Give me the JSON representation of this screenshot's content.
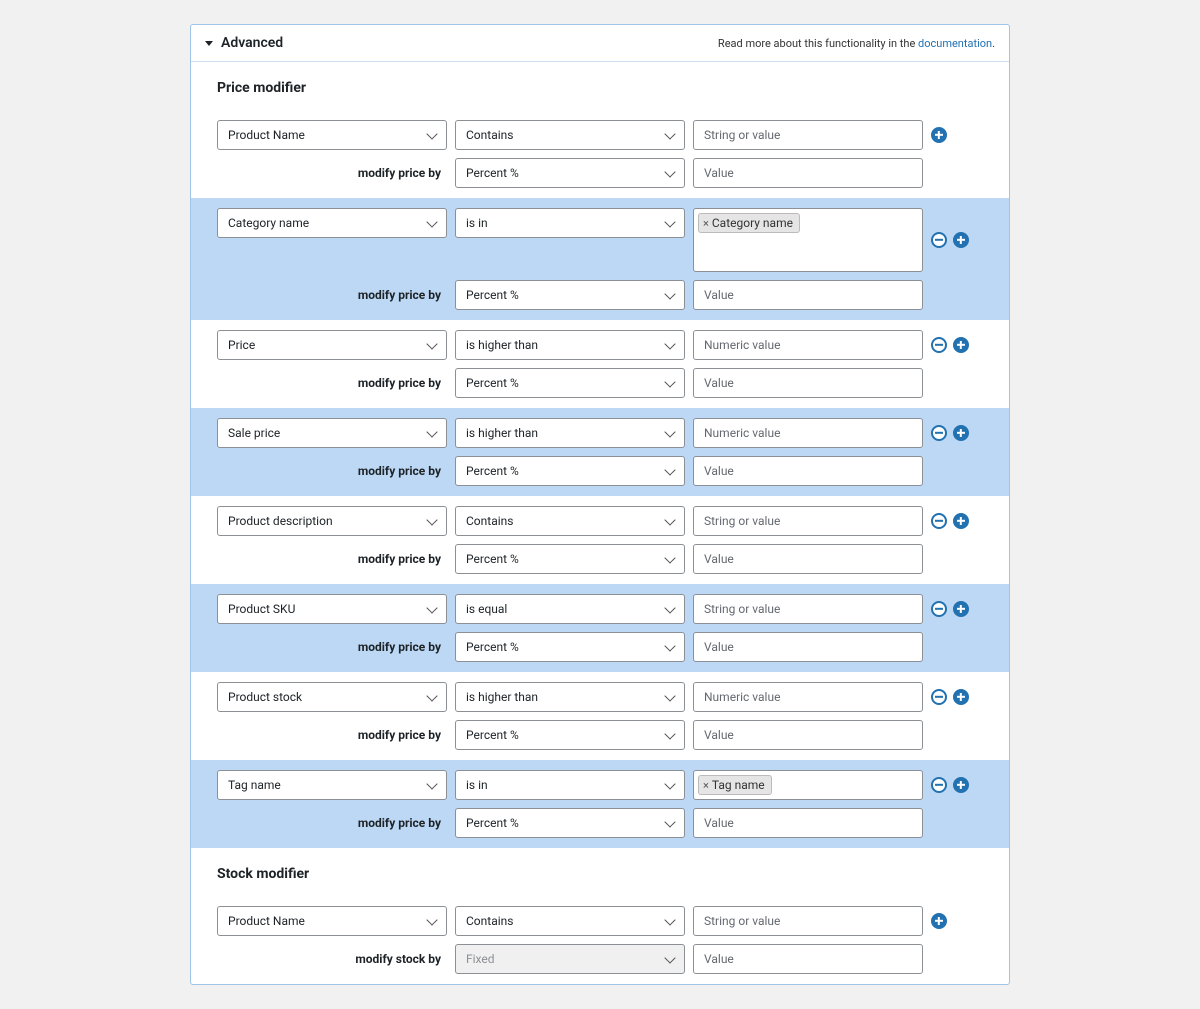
{
  "header": {
    "title": "Advanced",
    "hint_prefix": "Read more about this functionality in the ",
    "hint_link": "documentation",
    "hint_suffix": "."
  },
  "sections": {
    "price": {
      "title": "Price modifier",
      "modify_label": "modify price by",
      "rules": [
        {
          "alt": false,
          "field": "Product Name",
          "op": "Contains",
          "rhs_kind": "input",
          "rhs_placeholder": "String or value",
          "mod_type": "Percent %",
          "mod_value_placeholder": "Value",
          "show_remove": false
        },
        {
          "alt": true,
          "field": "Category name",
          "op": "is in",
          "rhs_kind": "tags_tall",
          "rhs_tags": [
            "Category name"
          ],
          "mod_type": "Percent %",
          "mod_value_placeholder": "Value",
          "show_remove": true
        },
        {
          "alt": false,
          "field": "Price",
          "op": "is higher than",
          "rhs_kind": "input",
          "rhs_placeholder": "Numeric value",
          "mod_type": "Percent %",
          "mod_value_placeholder": "Value",
          "show_remove": true
        },
        {
          "alt": true,
          "field": "Sale price",
          "op": "is higher than",
          "rhs_kind": "input",
          "rhs_placeholder": "Numeric value",
          "mod_type": "Percent %",
          "mod_value_placeholder": "Value",
          "show_remove": true
        },
        {
          "alt": false,
          "field": "Product description",
          "op": "Contains",
          "rhs_kind": "input",
          "rhs_placeholder": "String or value",
          "mod_type": "Percent %",
          "mod_value_placeholder": "Value",
          "show_remove": true
        },
        {
          "alt": true,
          "field": "Product SKU",
          "op": "is equal",
          "rhs_kind": "input",
          "rhs_placeholder": "String or value",
          "mod_type": "Percent %",
          "mod_value_placeholder": "Value",
          "show_remove": true
        },
        {
          "alt": false,
          "field": "Product stock",
          "op": "is higher than",
          "rhs_kind": "input",
          "rhs_placeholder": "Numeric value",
          "mod_type": "Percent %",
          "mod_value_placeholder": "Value",
          "show_remove": true
        },
        {
          "alt": true,
          "field": "Tag name",
          "op": "is in",
          "rhs_kind": "tags",
          "rhs_tags": [
            "Tag name"
          ],
          "mod_type": "Percent %",
          "mod_value_placeholder": "Value",
          "show_remove": true
        }
      ]
    },
    "stock": {
      "title": "Stock modifier",
      "modify_label": "modify stock by",
      "rules": [
        {
          "alt": false,
          "field": "Product Name",
          "op": "Contains",
          "rhs_kind": "input",
          "rhs_placeholder": "String or value",
          "mod_type": "Fixed",
          "mod_disabled": true,
          "mod_value_placeholder": "Value",
          "show_remove": false
        }
      ]
    }
  }
}
